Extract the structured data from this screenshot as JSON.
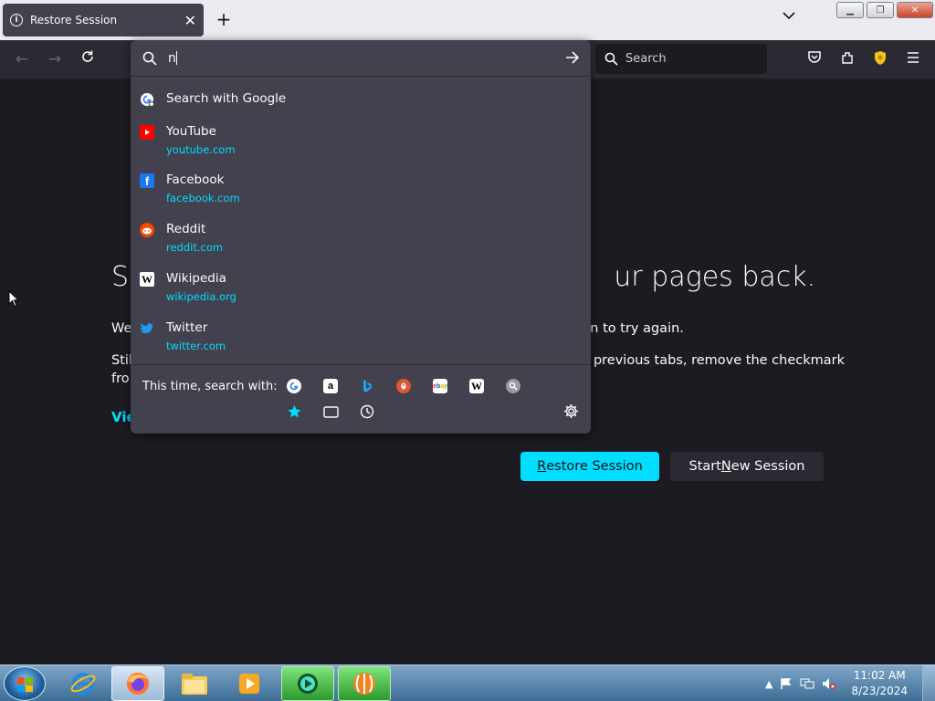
{
  "tab": {
    "title": "Restore Session"
  },
  "navbar": {
    "search_placeholder": "Search"
  },
  "urlbar": {
    "typed": "n"
  },
  "results": [
    {
      "title": "Search with Google",
      "url": "",
      "icon": "google-icon"
    },
    {
      "title": "YouTube",
      "url": "youtube.com",
      "icon": "youtube-icon"
    },
    {
      "title": "Facebook",
      "url": "facebook.com",
      "icon": "facebook-icon"
    },
    {
      "title": "Reddit",
      "url": "reddit.com",
      "icon": "reddit-icon"
    },
    {
      "title": "Wikipedia",
      "url": "wikipedia.org",
      "icon": "wikipedia-icon"
    },
    {
      "title": "Twitter",
      "url": "twitter.com",
      "icon": "twitter-icon"
    }
  ],
  "oneoff": {
    "label": "This time, search with:",
    "engines": [
      "google-icon",
      "amazon-icon",
      "bing-icon",
      "duckduckgo-icon",
      "ebay-icon",
      "wikipedia-icon",
      "search-icon"
    ],
    "modes": [
      "bookmarks-icon",
      "tabs-icon",
      "history-icon"
    ]
  },
  "page": {
    "title_left": "So",
    "title_right": "ur pages back.",
    "line1_left": "We",
    "line1_right": "on to try again.",
    "line2_left": "Stil",
    "line2_right": "previous tabs, remove the checkmark",
    "line3_left": "fro",
    "view_link": "Vie",
    "restore_button": "Restore Session",
    "new_session_button": "Start New Session"
  },
  "taskbar": {
    "time": "11:02 AM",
    "date": "8/23/2024",
    "apps": [
      "internet-explorer-icon",
      "firefox-icon",
      "file-explorer-icon",
      "media-player-icon",
      "app-green-icon",
      "app-orange-icon"
    ]
  },
  "colors": {
    "accent": "#00ddff",
    "panel": "#42414d",
    "background": "#1c1b22"
  }
}
